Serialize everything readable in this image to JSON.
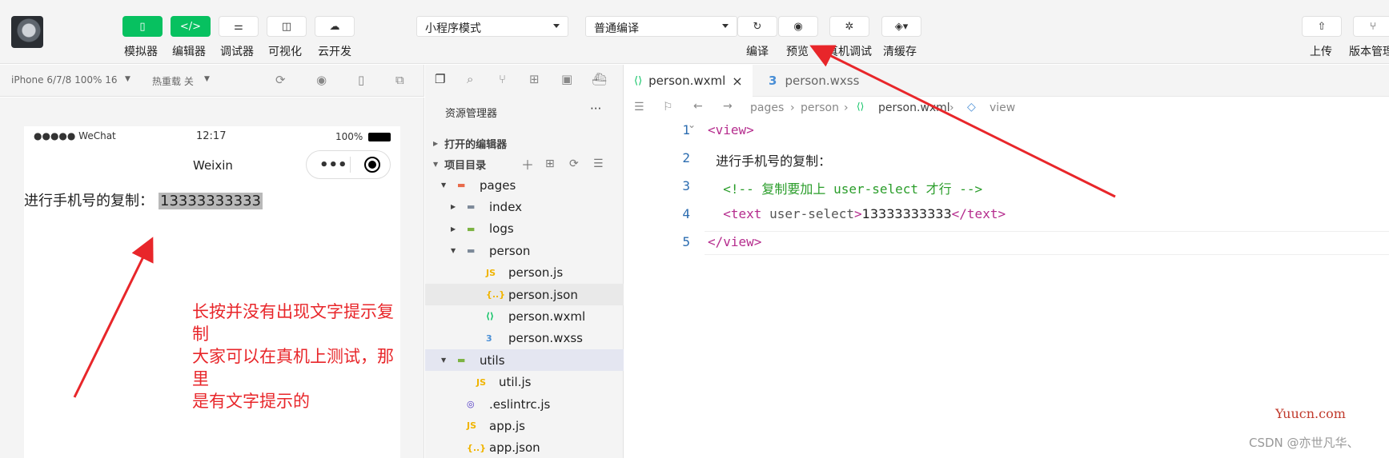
{
  "toolbar": {
    "buttons": [
      {
        "label": "模拟器",
        "icon": "phone-icon"
      },
      {
        "label": "编辑器",
        "icon": "code-icon"
      },
      {
        "label": "调试器",
        "icon": "sliders-icon"
      },
      {
        "label": "可视化",
        "icon": "layout-icon"
      },
      {
        "label": "云开发",
        "icon": "cloud-icon"
      }
    ],
    "mode_select": "小程序模式",
    "compile_select": "普通编译",
    "right_buttons": [
      {
        "label": "编译",
        "icon": "refresh-icon"
      },
      {
        "label": "预览",
        "icon": "eye-icon"
      },
      {
        "label": "真机调试",
        "icon": "bug-icon"
      },
      {
        "label": "清缓存",
        "icon": "layers-icon"
      }
    ],
    "far_right": [
      {
        "label": "上传",
        "icon": "upload-icon"
      },
      {
        "label": "版本管理",
        "icon": "branch-icon"
      }
    ]
  },
  "simulator": {
    "device": "iPhone 6/7/8 100% 16",
    "hot_reload": "热重载 关",
    "status_carrier": "●●●●● WeChat",
    "status_time": "12:17",
    "status_battery": "100%",
    "nav_title": "Weixin",
    "content_label": "进行手机号的复制：",
    "content_phone": "13333333333"
  },
  "explorer": {
    "title": "资源管理器",
    "more": "···",
    "open_editors": "打开的编辑器",
    "project_dir": "项目目录",
    "tree": [
      {
        "label": "pages",
        "depth": 1,
        "arrow": "open",
        "type": "folder-red"
      },
      {
        "label": "index",
        "depth": 2,
        "arrow": "closed",
        "type": "folder"
      },
      {
        "label": "logs",
        "depth": 2,
        "arrow": "closed",
        "type": "folder-green"
      },
      {
        "label": "person",
        "depth": 2,
        "arrow": "open",
        "type": "folder"
      },
      {
        "label": "person.js",
        "depth": 3,
        "type": "js"
      },
      {
        "label": "person.json",
        "depth": 3,
        "type": "json",
        "selected": true
      },
      {
        "label": "person.wxml",
        "depth": 3,
        "type": "wxml"
      },
      {
        "label": "person.wxss",
        "depth": 3,
        "type": "wxss"
      },
      {
        "label": "utils",
        "depth": 1,
        "arrow": "open",
        "type": "folder-green",
        "highlight": true
      },
      {
        "label": "util.js",
        "depth": 2,
        "type": "js"
      },
      {
        "label": ".eslintrc.js",
        "depth": 1,
        "type": "eslint"
      },
      {
        "label": "app.js",
        "depth": 1,
        "type": "js"
      },
      {
        "label": "app.json",
        "depth": 1,
        "type": "json"
      }
    ]
  },
  "editor": {
    "tabs": [
      {
        "label": "person.wxml",
        "active": true,
        "close": "×"
      },
      {
        "label": "person.wxss",
        "active": false
      }
    ],
    "breadcrumb": [
      "pages",
      "person",
      "person.wxml",
      "view"
    ],
    "lines": [
      {
        "num": "1",
        "parts": [
          {
            "t": "<",
            "c": "tag"
          },
          {
            "t": "view",
            "c": "tag"
          },
          {
            "t": ">",
            "c": "tag"
          }
        ]
      },
      {
        "num": "2",
        "parts": [
          {
            "t": "  进行手机号的复制：",
            "c": "text"
          }
        ]
      },
      {
        "num": "3",
        "parts": [
          {
            "t": "  <!-- 复制要加上 user-select 才行 -->",
            "c": "comment"
          }
        ]
      },
      {
        "num": "4",
        "parts": [
          {
            "t": "  <text",
            "c": "tag"
          },
          {
            "t": " user-select",
            "c": "attr"
          },
          {
            "t": ">",
            "c": "tag"
          },
          {
            "t": "13333333333",
            "c": "text"
          },
          {
            "t": "</text>",
            "c": "tag"
          }
        ]
      },
      {
        "num": "5",
        "parts": [
          {
            "t": "</view>",
            "c": "tag"
          }
        ]
      }
    ]
  },
  "annotation": [
    "长按并没有出现文字提示复制",
    "大家可以在真机上测试，那里",
    "是有文字提示的"
  ],
  "watermark_site": "Yuucn.com",
  "watermark_csdn": "CSDN @亦世凡华、",
  "colors": {
    "tag": "#b52c8d",
    "attr": "#555",
    "comment": "#2a9d2a",
    "text": "#222",
    "red": "#e8262a",
    "green": "#07c160"
  }
}
